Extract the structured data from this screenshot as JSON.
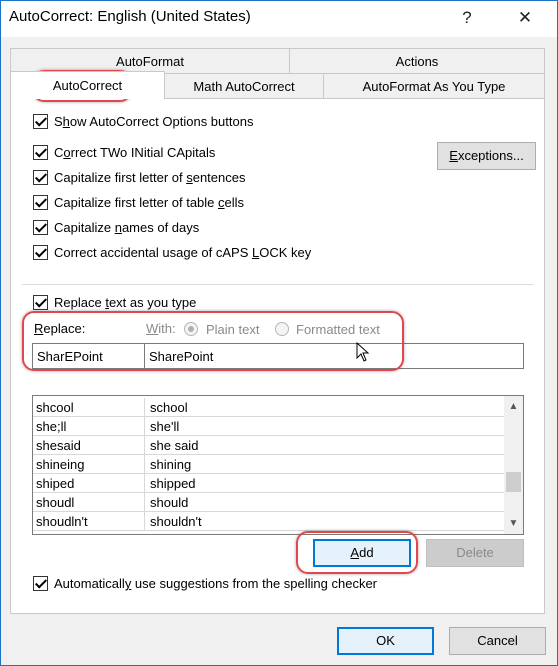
{
  "window": {
    "title": "AutoCorrect: English (United States)",
    "help_glyph": "?",
    "close_glyph": "✕"
  },
  "tabs": {
    "row1": [
      "AutoFormat",
      "Actions"
    ],
    "row2": [
      "AutoCorrect",
      "Math AutoCorrect",
      "AutoFormat As You Type"
    ],
    "active": "AutoCorrect"
  },
  "options": {
    "show_buttons": {
      "pre": "S",
      "u": "h",
      "post": "ow AutoCorrect Options buttons",
      "checked": true
    },
    "correct_two_initial": {
      "pre": "C",
      "u": "o",
      "post": "rrect TWo INitial CApitals",
      "checked": true
    },
    "capitalize_sentences": {
      "pre": "Capitalize first letter of ",
      "u": "s",
      "post": "entences",
      "checked": true
    },
    "capitalize_table": {
      "pre": "Capitalize first letter of table ",
      "u": "c",
      "post": "ells",
      "checked": true
    },
    "capitalize_days": {
      "pre": "Capitalize ",
      "u": "n",
      "post": "ames of days",
      "checked": true
    },
    "caps_lock": {
      "pre": "Correct accidental usage of cAPS ",
      "u": "L",
      "post": "OCK key",
      "checked": true
    },
    "exceptions_button": {
      "pre": "",
      "u": "E",
      "post": "xceptions..."
    }
  },
  "replace_section": {
    "replace_as_type": {
      "pre": "Replace ",
      "u": "t",
      "post": "ext as you type",
      "checked": true
    },
    "replace_label": {
      "pre": "",
      "u": "R",
      "post": "eplace:"
    },
    "with_label": {
      "pre": "",
      "u": "W",
      "post": "ith:"
    },
    "plain_text": "Plain text",
    "formatted_text": "Formatted text",
    "plain_selected": true,
    "replace_value": "SharEPoint",
    "with_value": "SharePoint"
  },
  "entries": [
    {
      "from": "shcool",
      "to": "school"
    },
    {
      "from": "she;ll",
      "to": "she'll"
    },
    {
      "from": "shesaid",
      "to": "she said"
    },
    {
      "from": "shineing",
      "to": "shining"
    },
    {
      "from": "shiped",
      "to": "shipped"
    },
    {
      "from": "shoudl",
      "to": "should"
    },
    {
      "from": "shoudln't",
      "to": "shouldn't"
    }
  ],
  "buttons": {
    "add": {
      "pre": "",
      "u": "A",
      "post": "dd"
    },
    "delete": "Delete",
    "ok": "OK",
    "cancel": "Cancel"
  },
  "spelling_suggestions": {
    "pre": "Automaticall",
    "u": "y",
    "post": " use suggestions from the spelling checker",
    "checked": true
  },
  "colors": {
    "highlight": "#e0484e",
    "accent": "#0078d7"
  }
}
